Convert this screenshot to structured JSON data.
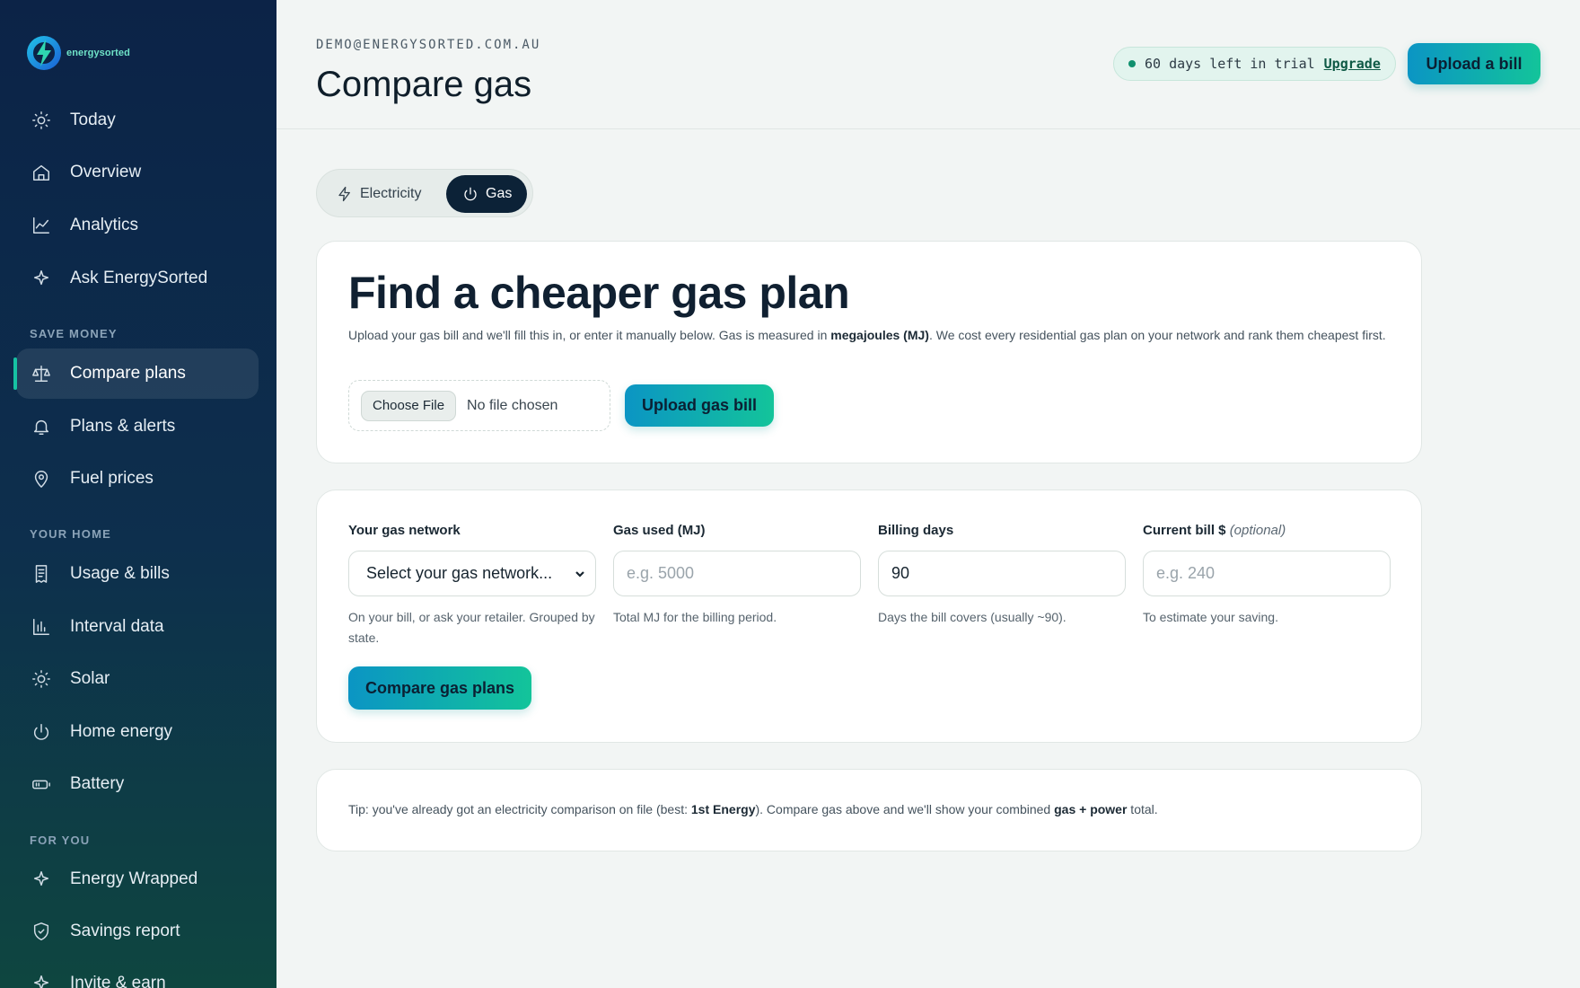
{
  "brand": {
    "name": "energysorted",
    "logo_icon": "bolt-logo-icon"
  },
  "sidebar": {
    "items": [
      {
        "label": "Today",
        "icon": "sun-icon"
      },
      {
        "label": "Overview",
        "icon": "home-icon"
      },
      {
        "label": "Analytics",
        "icon": "chart-line-icon"
      },
      {
        "label": "Ask EnergySorted",
        "icon": "sparkle-icon"
      },
      {
        "label": "Compare plans",
        "icon": "scales-icon",
        "active": true
      },
      {
        "label": "Plans & alerts",
        "icon": "bell-icon"
      },
      {
        "label": "Fuel prices",
        "icon": "map-pin-icon"
      },
      {
        "label": "Usage & bills",
        "icon": "receipt-icon"
      },
      {
        "label": "Interval data",
        "icon": "bar-chart-icon"
      },
      {
        "label": "Solar",
        "icon": "sun-icon"
      },
      {
        "label": "Home energy",
        "icon": "power-icon"
      },
      {
        "label": "Battery",
        "icon": "battery-icon"
      },
      {
        "label": "Energy Wrapped",
        "icon": "sparkle-icon"
      },
      {
        "label": "Savings report",
        "icon": "shield-icon"
      },
      {
        "label": "Invite & earn",
        "icon": "sparkle-icon"
      }
    ],
    "sections": [
      "SAVE MONEY",
      "YOUR HOME",
      "FOR YOU"
    ]
  },
  "header": {
    "email": "DEMO@ENERGYSORTED.COM.AU",
    "title": "Compare gas",
    "trial_text": "60 days left in trial",
    "upgrade_label": "Upgrade",
    "upload_bill_label": "Upload a bill"
  },
  "tabs": {
    "electricity": "Electricity",
    "gas": "Gas",
    "selected": "Gas"
  },
  "finder": {
    "title": "Find a cheaper gas plan",
    "desc_pre": "Upload your gas bill and we'll fill this in, or enter it manually below. Gas is measured in ",
    "desc_bold": "megajoules (MJ)",
    "desc_post": ". We cost every residential gas plan on your network and rank them cheapest first.",
    "choose_file_label": "Choose File",
    "no_file_text": "No file chosen",
    "upload_gas_label": "Upload gas bill"
  },
  "form": {
    "network": {
      "label": "Your gas network",
      "selected": "Select your gas network...",
      "hint": "On your bill, or ask your retailer. Grouped by state."
    },
    "gas_used": {
      "label": "Gas used (MJ)",
      "placeholder": "e.g. 5000",
      "hint": "Total MJ for the billing period."
    },
    "billing_days": {
      "label": "Billing days",
      "value": "90",
      "hint": "Days the bill covers (usually ~90)."
    },
    "current_bill": {
      "label": "Current bill $",
      "label_optional": "(optional)",
      "placeholder": "e.g. 240",
      "hint": "To estimate your saving."
    },
    "compare_label": "Compare gas plans"
  },
  "tip": {
    "pre": "Tip: you've already got an electricity comparison on file (best: ",
    "best": "1st Energy",
    "mid": "). Compare gas above and we'll show your combined ",
    "combined": "gas + power",
    "post": " total."
  },
  "colors": {
    "accent_start": "#0b95c4",
    "accent_end": "#13c49a",
    "sidebar_top": "#0c2347",
    "sidebar_bottom": "#0e4640",
    "active_tab": "#0c2237"
  }
}
